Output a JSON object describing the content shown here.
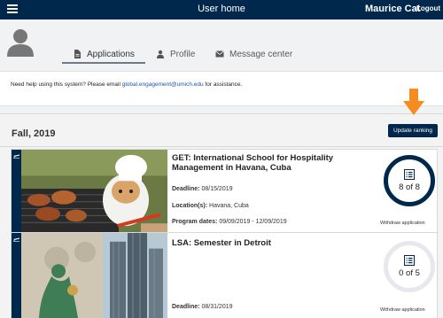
{
  "topbar": {
    "title": "User home",
    "user_name": "Maurice Cat",
    "logout_label": "Logout",
    "menu_icon": "hamburger-menu-icon"
  },
  "tabs": [
    {
      "label": "Applications",
      "icon": "document-icon",
      "active": true
    },
    {
      "label": "Profile",
      "icon": "person-icon",
      "active": false
    },
    {
      "label": "Message center",
      "icon": "envelope-icon",
      "active": false
    }
  ],
  "help": {
    "before": "Need help using this system? Please email ",
    "email": "global.engagement@umich.edu",
    "after": " for assistance."
  },
  "term": {
    "title": "Fall, 2019",
    "update_ranking_label": "Update ranking"
  },
  "applications": [
    {
      "name": "GET: International School for Hospitality Management in Havana, Cuba",
      "deadline_label": "Deadline:",
      "deadline": "08/15/2019",
      "location_label": "Location(s):",
      "location": "Havana, Cuba",
      "dates_label": "Program dates:",
      "dates": "09/09/2019 - 12/09/2019",
      "progress_text": "8 of 8",
      "progress_fraction": 1.0,
      "withdraw_label": "Withdraw application"
    },
    {
      "name": "LSA: Semester in Detroit",
      "deadline_label": "Deadline:",
      "deadline": "08/31/2019",
      "progress_text": "0 of 5",
      "progress_fraction": 0.0,
      "withdraw_label": "Withdraw application"
    }
  ],
  "colors": {
    "navy": "#00274c",
    "accent_arrow": "#f68b1f",
    "link": "#1a55b5"
  }
}
